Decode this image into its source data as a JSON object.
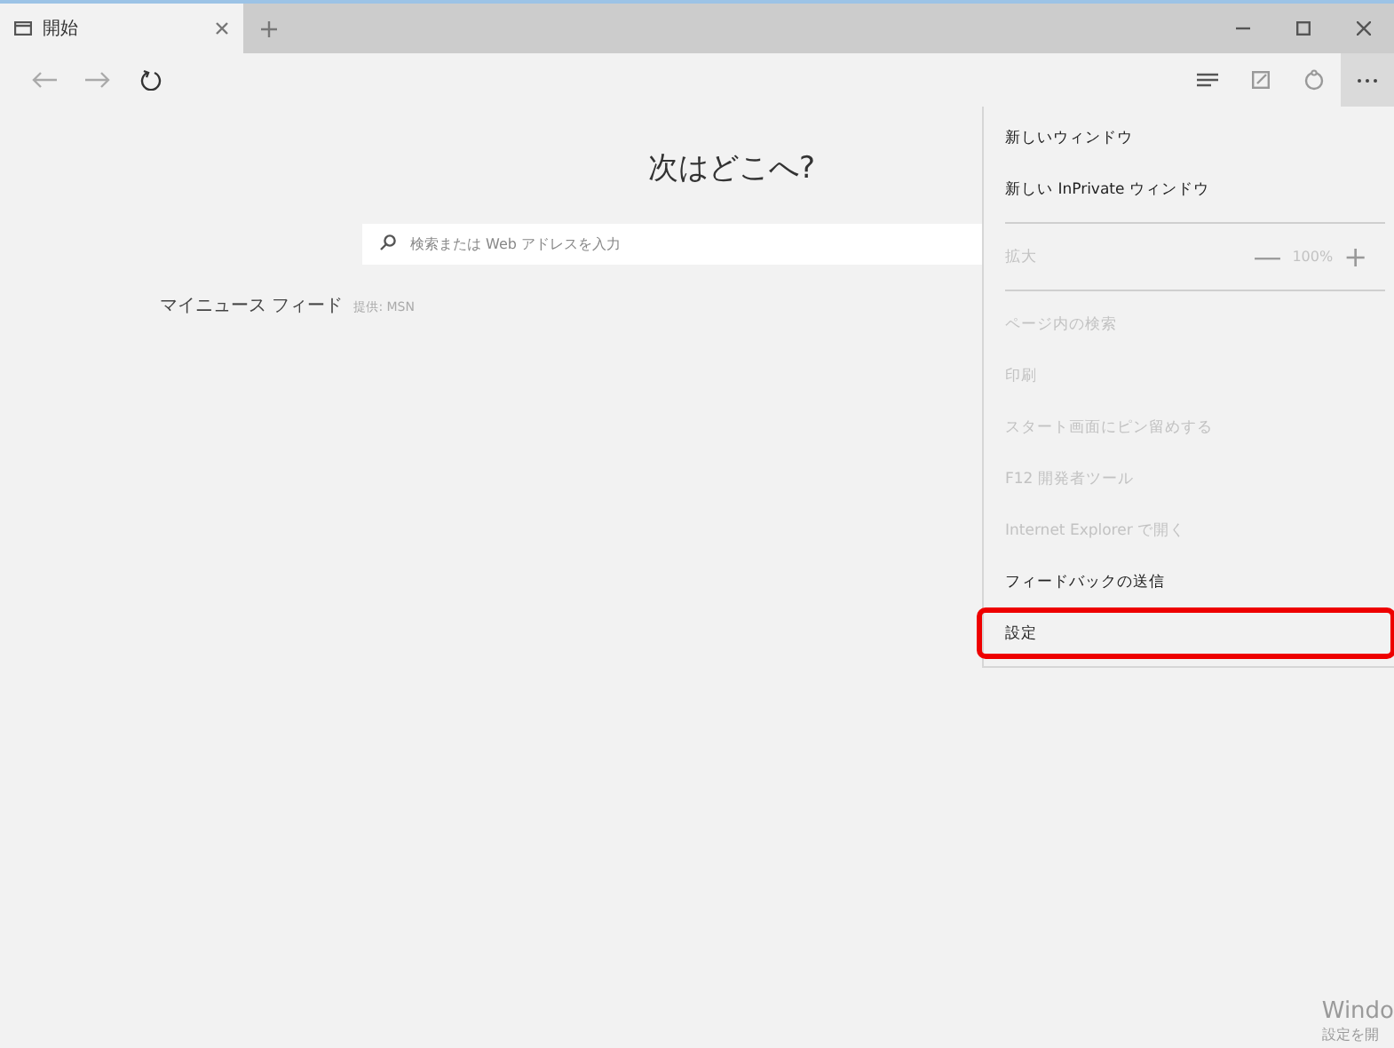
{
  "tabs": [
    {
      "label": "開始",
      "selected": true
    }
  ],
  "page": {
    "heading": "次はどこへ?",
    "search": {
      "placeholder": "検索または Web アドレスを入力"
    },
    "news_feed": {
      "title": "マイニュース フィード",
      "provider": "提供: MSN"
    }
  },
  "menu": [
    {
      "kind": "item",
      "label": "新しいウィンドウ",
      "disabled": false,
      "highlighted": false
    },
    {
      "kind": "item",
      "label": "新しい InPrivate ウィンドウ",
      "disabled": false,
      "highlighted": false
    },
    {
      "kind": "separator"
    },
    {
      "kind": "zoom",
      "label": "拡大",
      "value": "100%",
      "minus": "—",
      "plus": "+",
      "disabled": true
    },
    {
      "kind": "separator"
    },
    {
      "kind": "item",
      "label": "ページ内の検索",
      "disabled": true,
      "highlighted": false
    },
    {
      "kind": "item",
      "label": "印刷",
      "disabled": true,
      "highlighted": false
    },
    {
      "kind": "item",
      "label": "スタート画面にピン留めする",
      "disabled": true,
      "highlighted": false
    },
    {
      "kind": "item",
      "label": "F12 開発者ツール",
      "disabled": true,
      "highlighted": false
    },
    {
      "kind": "item",
      "label": "Internet Explorer で開く",
      "disabled": true,
      "highlighted": false
    },
    {
      "kind": "item",
      "label": "フィードバックの送信",
      "disabled": false,
      "highlighted": false
    },
    {
      "kind": "item",
      "label": "設定",
      "disabled": false,
      "highlighted": true
    }
  ],
  "activation_notice": [
    "Windo",
    "設定を開"
  ]
}
